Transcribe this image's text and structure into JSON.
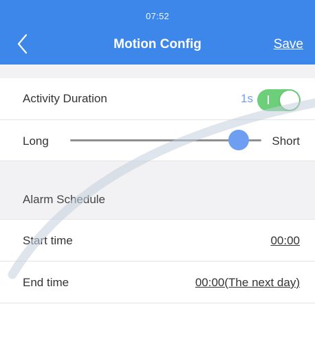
{
  "status_bar": {
    "time": "07:52"
  },
  "header": {
    "title": "Motion Config",
    "save_label": "Save"
  },
  "activity": {
    "label": "Activity Duration",
    "value": "1s",
    "toggle_on": true
  },
  "sensitivity": {
    "left_label": "Long",
    "right_label": "Short",
    "value": 0.88
  },
  "schedule": {
    "heading": "Alarm Schedule",
    "start": {
      "label": "Start time",
      "value": "00:00"
    },
    "end": {
      "label": "End time",
      "value": "00:00(The next day)"
    }
  },
  "colors": {
    "header": "#3d87ea",
    "accent": "#6e9ef1",
    "toggle_on": "#6cd07a"
  },
  "icons": {
    "back": "chevron-left-icon"
  }
}
